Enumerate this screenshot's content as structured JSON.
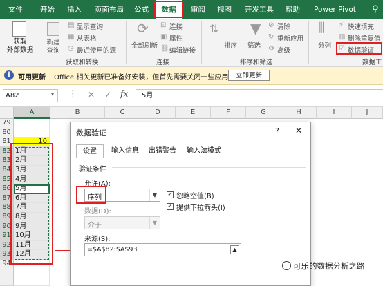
{
  "menu": {
    "items": [
      "文件",
      "开始",
      "插入",
      "页面布局",
      "公式",
      "数据",
      "审阅",
      "视图",
      "开发工具",
      "帮助",
      "Power Pivot"
    ],
    "active": "数据"
  },
  "ribbon": {
    "get_data": "获取\n外部数据",
    "new_query": "新建\n查询",
    "show_query": "显示查询",
    "from_table": "从表格",
    "recent_sources": "最近使用的源",
    "get_transform": "获取和转换",
    "refresh_all": "全部刷新",
    "connections": "连接",
    "properties": "属性",
    "edit_links": "编辑链接",
    "connections_group": "连接",
    "sort": "排序",
    "filter": "筛选",
    "clear": "清除",
    "reapply": "重新应用",
    "advanced": "高级",
    "sort_filter_group": "排序和筛选",
    "text_to_columns": "分列",
    "flash_fill": "快速填充",
    "remove_duplicates": "删除重复值",
    "data_validation": "数据验证",
    "data_tools_group": "数据工"
  },
  "notice": {
    "title": "可用更新",
    "message": "Office 相关更新已准备好安装，但首先需要关闭一些应用。",
    "button": "立即更新"
  },
  "formula_bar": {
    "name_box": "A82",
    "fx": "fx",
    "value": "5月"
  },
  "grid": {
    "columns": [
      "A",
      "B",
      "C",
      "D",
      "E",
      "F",
      "G",
      "H",
      "I",
      "J"
    ],
    "rows": [
      "79",
      "80",
      "81",
      "82",
      "83",
      "84",
      "85",
      "86",
      "87",
      "88",
      "89",
      "90",
      "91",
      "92",
      "93",
      "94"
    ],
    "a81": "10",
    "months": [
      "1月",
      "2月",
      "3月",
      "4月",
      "5月",
      "6月",
      "7月",
      "8月",
      "9月",
      "10月",
      "11月",
      "12月"
    ]
  },
  "dialog": {
    "title": "数据验证",
    "help": "?",
    "close": "✕",
    "tabs": [
      "设置",
      "输入信息",
      "出错警告",
      "输入法模式"
    ],
    "section": "验证条件",
    "allow_label": "允许(A):",
    "allow_value": "序列",
    "ignore_blank": "忽略空值(B)",
    "dropdown_arrow": "提供下拉箭头(I)",
    "data_label": "数据(D):",
    "data_value": "介于",
    "source_label": "来源(S):",
    "source_value": "=$A$82:$A$93"
  },
  "watermark": "可乐的数据分析之路",
  "colors": {
    "excel_green": "#217346",
    "highlight_red": "#e02020",
    "yellow_cell": "#ffff00"
  }
}
